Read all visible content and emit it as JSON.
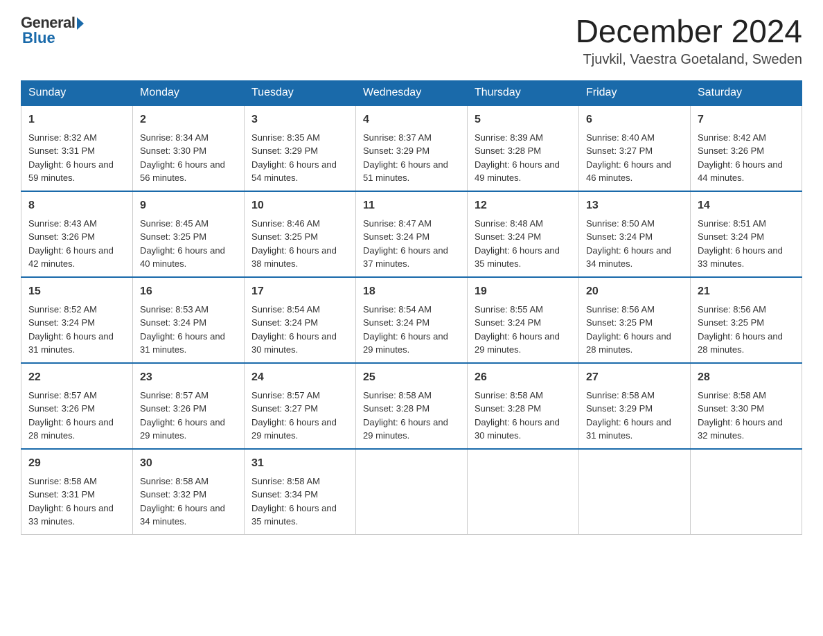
{
  "logo": {
    "general": "General",
    "blue": "Blue"
  },
  "header": {
    "month": "December 2024",
    "location": "Tjuvkil, Vaestra Goetaland, Sweden"
  },
  "days": [
    "Sunday",
    "Monday",
    "Tuesday",
    "Wednesday",
    "Thursday",
    "Friday",
    "Saturday"
  ],
  "weeks": [
    [
      {
        "num": "1",
        "sunrise": "8:32 AM",
        "sunset": "3:31 PM",
        "daylight": "6 hours and 59 minutes."
      },
      {
        "num": "2",
        "sunrise": "8:34 AM",
        "sunset": "3:30 PM",
        "daylight": "6 hours and 56 minutes."
      },
      {
        "num": "3",
        "sunrise": "8:35 AM",
        "sunset": "3:29 PM",
        "daylight": "6 hours and 54 minutes."
      },
      {
        "num": "4",
        "sunrise": "8:37 AM",
        "sunset": "3:29 PM",
        "daylight": "6 hours and 51 minutes."
      },
      {
        "num": "5",
        "sunrise": "8:39 AM",
        "sunset": "3:28 PM",
        "daylight": "6 hours and 49 minutes."
      },
      {
        "num": "6",
        "sunrise": "8:40 AM",
        "sunset": "3:27 PM",
        "daylight": "6 hours and 46 minutes."
      },
      {
        "num": "7",
        "sunrise": "8:42 AM",
        "sunset": "3:26 PM",
        "daylight": "6 hours and 44 minutes."
      }
    ],
    [
      {
        "num": "8",
        "sunrise": "8:43 AM",
        "sunset": "3:26 PM",
        "daylight": "6 hours and 42 minutes."
      },
      {
        "num": "9",
        "sunrise": "8:45 AM",
        "sunset": "3:25 PM",
        "daylight": "6 hours and 40 minutes."
      },
      {
        "num": "10",
        "sunrise": "8:46 AM",
        "sunset": "3:25 PM",
        "daylight": "6 hours and 38 minutes."
      },
      {
        "num": "11",
        "sunrise": "8:47 AM",
        "sunset": "3:24 PM",
        "daylight": "6 hours and 37 minutes."
      },
      {
        "num": "12",
        "sunrise": "8:48 AM",
        "sunset": "3:24 PM",
        "daylight": "6 hours and 35 minutes."
      },
      {
        "num": "13",
        "sunrise": "8:50 AM",
        "sunset": "3:24 PM",
        "daylight": "6 hours and 34 minutes."
      },
      {
        "num": "14",
        "sunrise": "8:51 AM",
        "sunset": "3:24 PM",
        "daylight": "6 hours and 33 minutes."
      }
    ],
    [
      {
        "num": "15",
        "sunrise": "8:52 AM",
        "sunset": "3:24 PM",
        "daylight": "6 hours and 31 minutes."
      },
      {
        "num": "16",
        "sunrise": "8:53 AM",
        "sunset": "3:24 PM",
        "daylight": "6 hours and 31 minutes."
      },
      {
        "num": "17",
        "sunrise": "8:54 AM",
        "sunset": "3:24 PM",
        "daylight": "6 hours and 30 minutes."
      },
      {
        "num": "18",
        "sunrise": "8:54 AM",
        "sunset": "3:24 PM",
        "daylight": "6 hours and 29 minutes."
      },
      {
        "num": "19",
        "sunrise": "8:55 AM",
        "sunset": "3:24 PM",
        "daylight": "6 hours and 29 minutes."
      },
      {
        "num": "20",
        "sunrise": "8:56 AM",
        "sunset": "3:25 PM",
        "daylight": "6 hours and 28 minutes."
      },
      {
        "num": "21",
        "sunrise": "8:56 AM",
        "sunset": "3:25 PM",
        "daylight": "6 hours and 28 minutes."
      }
    ],
    [
      {
        "num": "22",
        "sunrise": "8:57 AM",
        "sunset": "3:26 PM",
        "daylight": "6 hours and 28 minutes."
      },
      {
        "num": "23",
        "sunrise": "8:57 AM",
        "sunset": "3:26 PM",
        "daylight": "6 hours and 29 minutes."
      },
      {
        "num": "24",
        "sunrise": "8:57 AM",
        "sunset": "3:27 PM",
        "daylight": "6 hours and 29 minutes."
      },
      {
        "num": "25",
        "sunrise": "8:58 AM",
        "sunset": "3:28 PM",
        "daylight": "6 hours and 29 minutes."
      },
      {
        "num": "26",
        "sunrise": "8:58 AM",
        "sunset": "3:28 PM",
        "daylight": "6 hours and 30 minutes."
      },
      {
        "num": "27",
        "sunrise": "8:58 AM",
        "sunset": "3:29 PM",
        "daylight": "6 hours and 31 minutes."
      },
      {
        "num": "28",
        "sunrise": "8:58 AM",
        "sunset": "3:30 PM",
        "daylight": "6 hours and 32 minutes."
      }
    ],
    [
      {
        "num": "29",
        "sunrise": "8:58 AM",
        "sunset": "3:31 PM",
        "daylight": "6 hours and 33 minutes."
      },
      {
        "num": "30",
        "sunrise": "8:58 AM",
        "sunset": "3:32 PM",
        "daylight": "6 hours and 34 minutes."
      },
      {
        "num": "31",
        "sunrise": "8:58 AM",
        "sunset": "3:34 PM",
        "daylight": "6 hours and 35 minutes."
      },
      null,
      null,
      null,
      null
    ]
  ]
}
